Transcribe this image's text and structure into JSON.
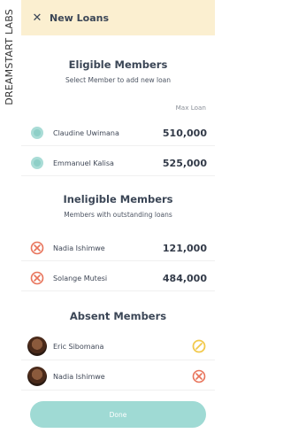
{
  "watermark": "DREAMSTART LABS",
  "header": {
    "close_icon": "close-icon",
    "title": "New Loans"
  },
  "eligible": {
    "title": "Eligible Members",
    "subtitle": "Select Member to add new loan",
    "column_label": "Max Loan",
    "members": [
      {
        "name": "Claudine Uwimana",
        "amount": "510,000",
        "icon": "unselected-radio-icon"
      },
      {
        "name": "Emmanuel Kalisa",
        "amount": "525,000",
        "icon": "unselected-radio-icon"
      }
    ]
  },
  "ineligible": {
    "title": "Ineligible Members",
    "subtitle": "Members with outstanding loans",
    "members": [
      {
        "name": "Nadia Ishimwe",
        "amount": "121,000",
        "icon": "blocked-icon"
      },
      {
        "name": "Solange Mutesi",
        "amount": "484,000",
        "icon": "blocked-icon"
      }
    ]
  },
  "absent": {
    "title": "Absent Members",
    "members": [
      {
        "name": "Eric Sibomana",
        "status_icon": "excused-icon",
        "status_color": "#f2c94c"
      },
      {
        "name": "Nadia Ishimwe",
        "status_icon": "blocked-icon",
        "status_color": "#e8735a"
      }
    ]
  },
  "done_button": "Done",
  "colors": {
    "header_bg": "#fbefd0",
    "accent_teal": "#9fdad4",
    "danger": "#e8735a",
    "warning": "#f2c94c"
  }
}
